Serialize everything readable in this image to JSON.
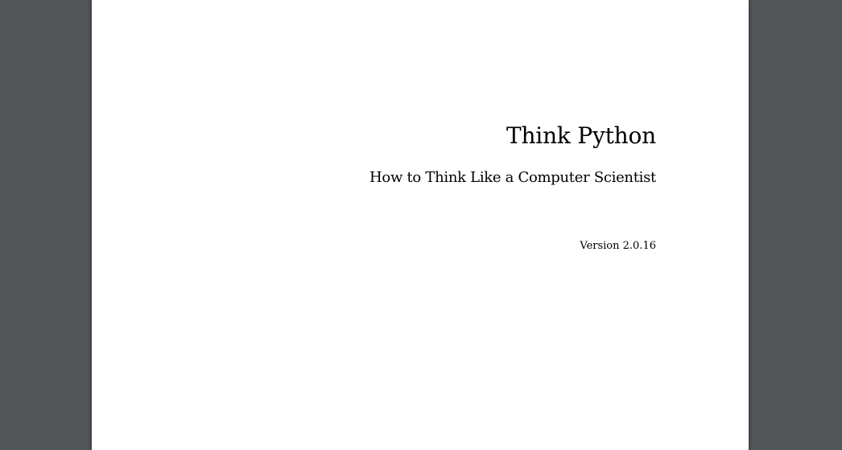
{
  "document": {
    "title": "Think Python",
    "subtitle": "How to Think Like a Computer Scientist",
    "version": "Version 2.0.16"
  },
  "colors": {
    "viewer_background": "#525659",
    "page_background": "#ffffff",
    "text": "#000000"
  }
}
